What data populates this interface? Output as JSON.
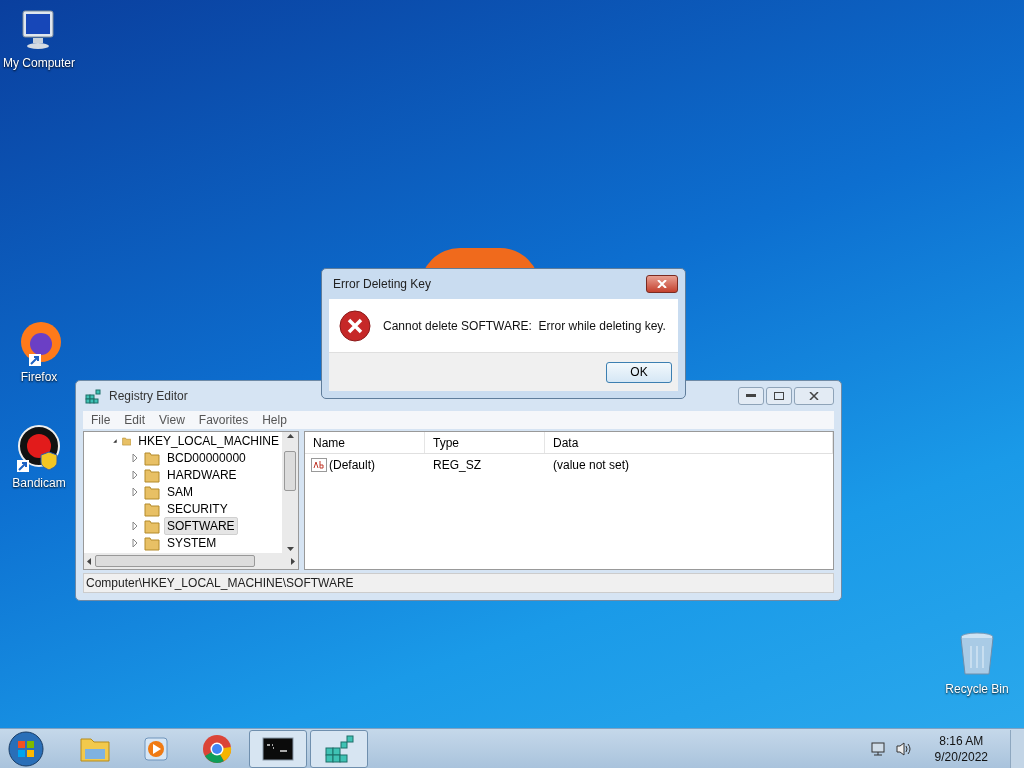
{
  "desktop_icons": [
    {
      "label": "My Computer",
      "kind": "computer"
    },
    {
      "label": "Firefox",
      "kind": "firefox"
    },
    {
      "label": "Bandicam",
      "kind": "bandicam"
    },
    {
      "label": "Recycle Bin",
      "kind": "recycle"
    }
  ],
  "registry_editor": {
    "title": "Registry Editor",
    "menu": [
      "File",
      "Edit",
      "View",
      "Favorites",
      "Help"
    ],
    "tree": {
      "label": "HKEY_LOCAL_MACHINE",
      "expanded": true,
      "selected": false,
      "children": [
        {
          "label": "BCD00000000",
          "expanded": false,
          "selected": false
        },
        {
          "label": "HARDWARE",
          "expanded": false,
          "selected": false
        },
        {
          "label": "SAM",
          "expanded": false,
          "selected": false
        },
        {
          "label": "SECURITY",
          "selected": false
        },
        {
          "label": "SOFTWARE",
          "expanded": false,
          "selected": true
        },
        {
          "label": "SYSTEM",
          "expanded": false,
          "selected": false
        }
      ]
    },
    "columns": [
      "Name",
      "Type",
      "Data"
    ],
    "rows": [
      {
        "name": "(Default)",
        "type": "REG_SZ",
        "data": "(value not set)"
      }
    ],
    "status_bar": "Computer\\HKEY_LOCAL_MACHINE\\SOFTWARE"
  },
  "dialog": {
    "title": "Error Deleting Key",
    "message": "Cannot delete SOFTWARE:  Error while deleting key.",
    "button": "OK"
  },
  "taskbar": {
    "items": [
      {
        "kind": "explorer",
        "open": false
      },
      {
        "kind": "media",
        "open": false
      },
      {
        "kind": "chrome",
        "open": false
      },
      {
        "kind": "cmd",
        "open": true
      },
      {
        "kind": "regedit",
        "open": true
      }
    ],
    "time": "8:16 AM",
    "date": "9/20/2022"
  }
}
